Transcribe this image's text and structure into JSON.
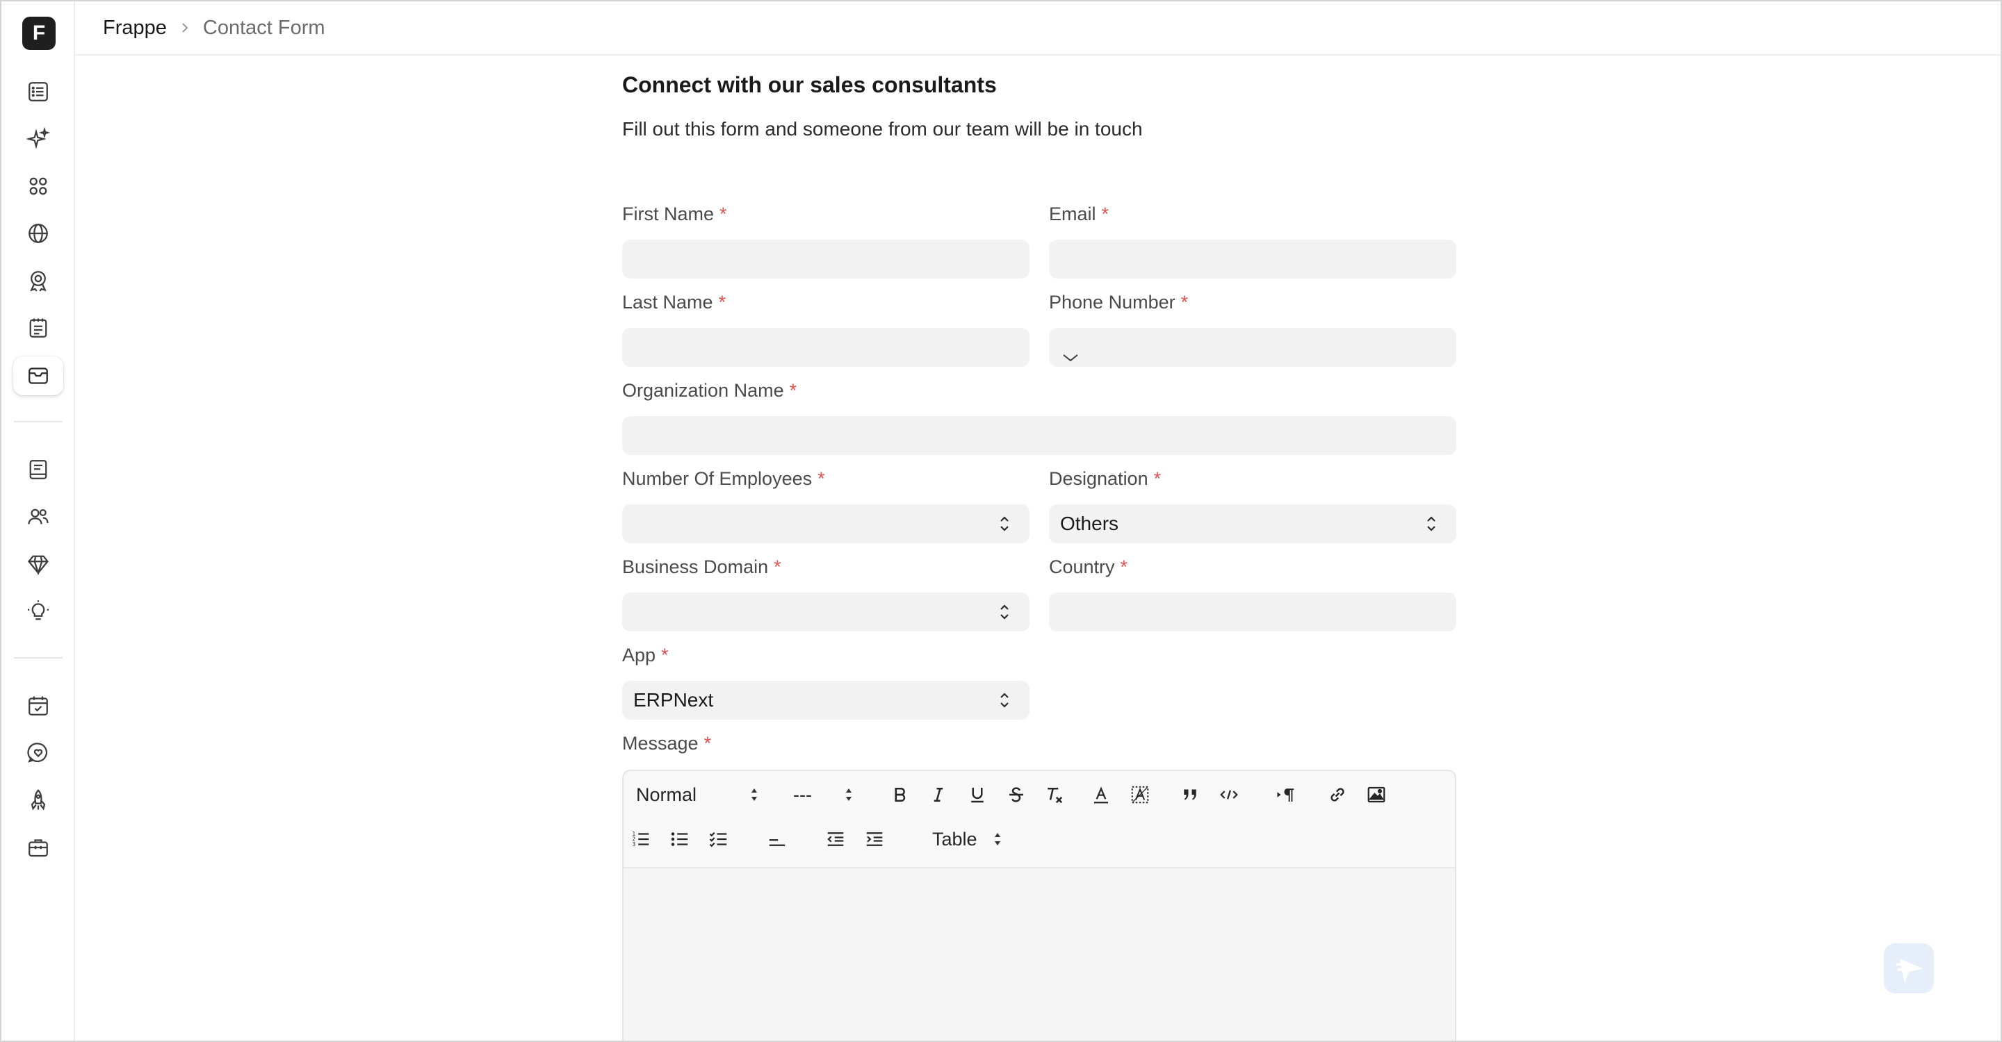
{
  "breadcrumb": {
    "root": "Frappe",
    "current": "Contact Form"
  },
  "sidebar": {
    "logo_letter": "F",
    "items": [
      {
        "icon": "list-icon"
      },
      {
        "icon": "sparkle-icon"
      },
      {
        "icon": "apps-grid-icon"
      },
      {
        "icon": "globe-icon"
      },
      {
        "icon": "award-icon"
      },
      {
        "icon": "notes-icon"
      },
      {
        "icon": "mail-icon",
        "active": true
      },
      {
        "icon": "book-icon"
      },
      {
        "icon": "users-icon"
      },
      {
        "icon": "diamond-icon"
      },
      {
        "icon": "lightbulb-icon"
      },
      {
        "icon": "calendar-check-icon"
      },
      {
        "icon": "chat-heart-icon"
      },
      {
        "icon": "rocket-icon"
      },
      {
        "icon": "briefcase-icon"
      }
    ]
  },
  "form": {
    "title": "Connect with our sales consultants",
    "subtitle": "Fill out this form and someone from our team will be in touch",
    "required_mark": "*",
    "fields": {
      "first_name": {
        "label": "First Name",
        "value": ""
      },
      "email": {
        "label": "Email",
        "value": ""
      },
      "last_name": {
        "label": "Last Name",
        "value": ""
      },
      "phone_number": {
        "label": "Phone Number",
        "value": ""
      },
      "organization_name": {
        "label": "Organization Name",
        "value": ""
      },
      "number_of_employees": {
        "label": "Number Of Employees",
        "value": ""
      },
      "designation": {
        "label": "Designation",
        "value": "Others"
      },
      "business_domain": {
        "label": "Business Domain",
        "value": ""
      },
      "country": {
        "label": "Country",
        "value": ""
      },
      "app": {
        "label": "App",
        "value": "ERPNext"
      },
      "message": {
        "label": "Message",
        "value": ""
      }
    }
  },
  "editor_toolbar": {
    "header_select": "Normal",
    "size_select": "---",
    "table_select": "Table"
  },
  "colors": {
    "required": "#e05252",
    "field_bg": "#f2f2f2",
    "fab_bg": "#e6eef9"
  }
}
